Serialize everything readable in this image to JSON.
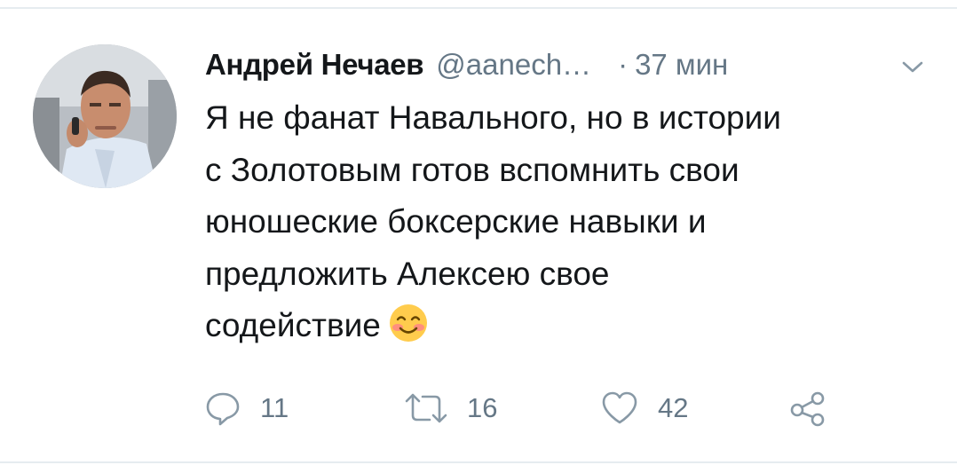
{
  "tweet": {
    "author": {
      "display_name": "Андрей Нечаев",
      "handle": "@aanech…",
      "avatar": "avatar-photo"
    },
    "separator": "·",
    "time": "37 мин",
    "menu_icon": "chevron-down-icon",
    "text_lines": [
      "Я не фанат Навального, но в истории",
      "с Золотовым готов вспомнить свои",
      "юношеские боксерские навыки и",
      "предложить Алексею свое",
      "содействие"
    ],
    "emoji": "smiling-face-with-blush-emoji",
    "actions": {
      "reply": {
        "icon": "reply-icon",
        "count": "11"
      },
      "retweet": {
        "icon": "retweet-icon",
        "count": "16"
      },
      "like": {
        "icon": "heart-icon",
        "count": "42"
      },
      "share": {
        "icon": "share-icon"
      }
    },
    "colors": {
      "text": "#14171a",
      "secondary": "#657786",
      "divider": "#e6ecf0"
    }
  }
}
